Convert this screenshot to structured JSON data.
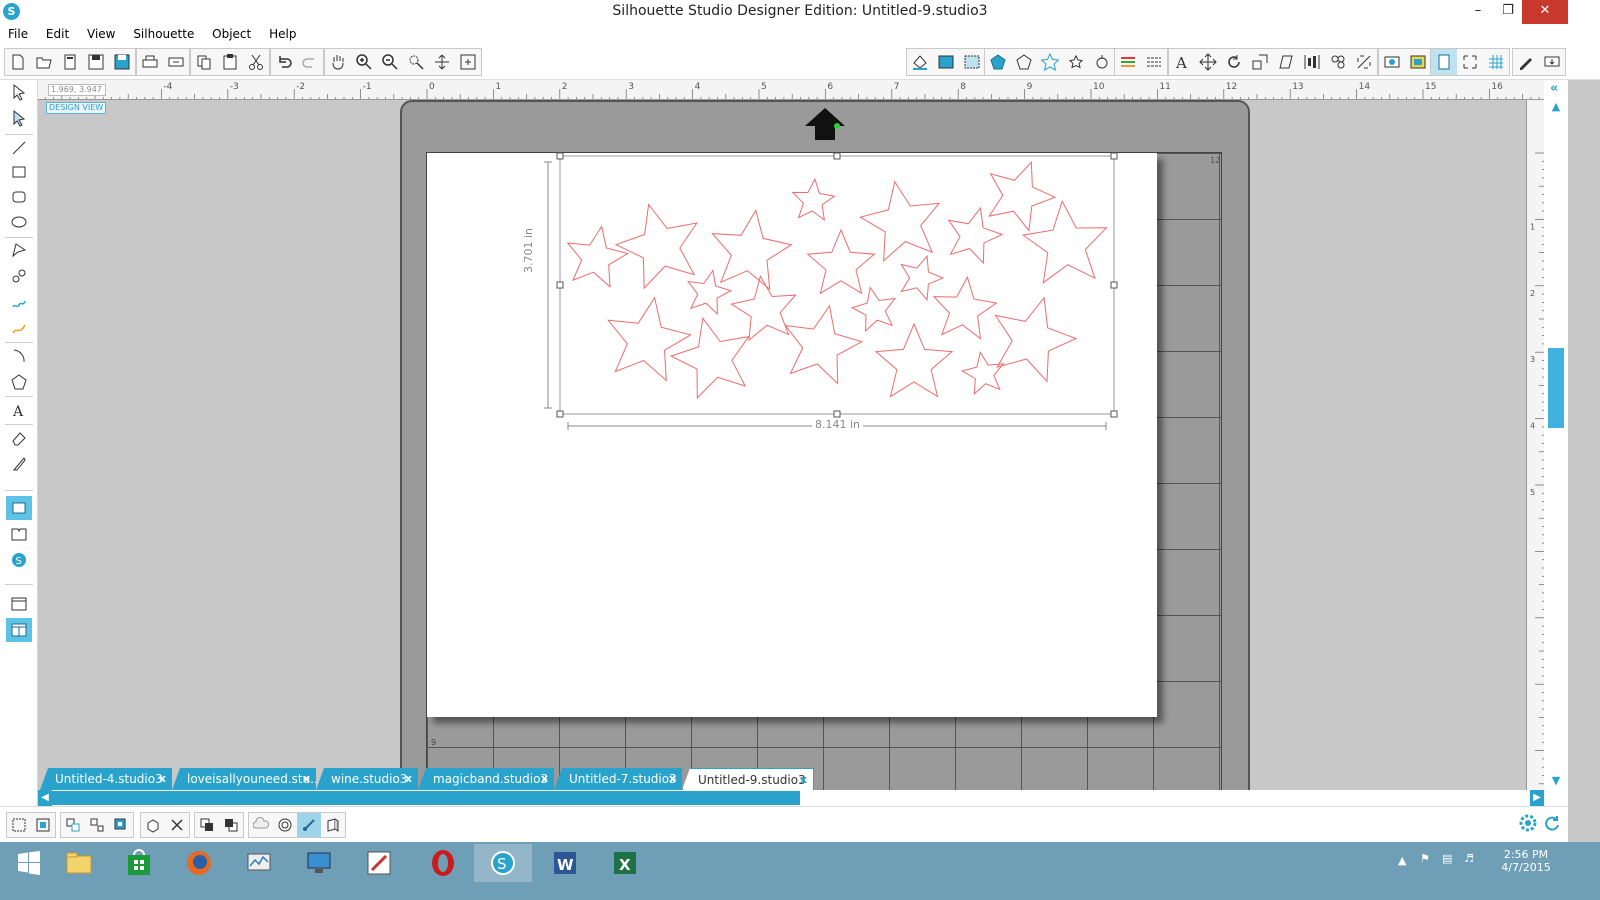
{
  "window": {
    "title": "Silhouette Studio Designer Edition: Untitled-9.studio3",
    "minimize_icon": "minimize-icon",
    "restore_icon": "restore-icon",
    "close_icon": "close-icon"
  },
  "menu": {
    "items": [
      "File",
      "Edit",
      "View",
      "Silhouette",
      "Object",
      "Help"
    ]
  },
  "canvas": {
    "coordinates": "1.969, 3.947",
    "design_view_label": "DESIGN VIEW",
    "selection_width": "8.141 in",
    "selection_height": "3.701 in",
    "ruler_top_labels": [
      "-4",
      "-3",
      "-2",
      "-1",
      "0",
      "1",
      "2",
      "3",
      "4",
      "5",
      "6",
      "7",
      "8",
      "9",
      "10",
      "11",
      "12",
      "13",
      "14",
      "15",
      "16"
    ],
    "ruler_right_labels": [
      "1",
      "2",
      "3",
      "4",
      "5"
    ],
    "mat_corner_label": "12",
    "mat_bottom_label": "9",
    "star_stroke_color": "#ef6b6b"
  },
  "tabs": [
    {
      "label": "Untitled-4.studio3",
      "active": false
    },
    {
      "label": "loveisallyouneed.stu...",
      "active": false
    },
    {
      "label": "wine.studio3",
      "active": false
    },
    {
      "label": "magicband.studio3",
      "active": false
    },
    {
      "label": "Untitled-7.studio3",
      "active": false
    },
    {
      "label": "Untitled-9.studio3",
      "active": true
    }
  ],
  "taskbar": {
    "time": "2:56 PM",
    "date": "4/7/2015"
  },
  "colors": {
    "accent": "#29a3cc",
    "taskbar": "#6f9fb6",
    "close_button": "#c7382d"
  }
}
